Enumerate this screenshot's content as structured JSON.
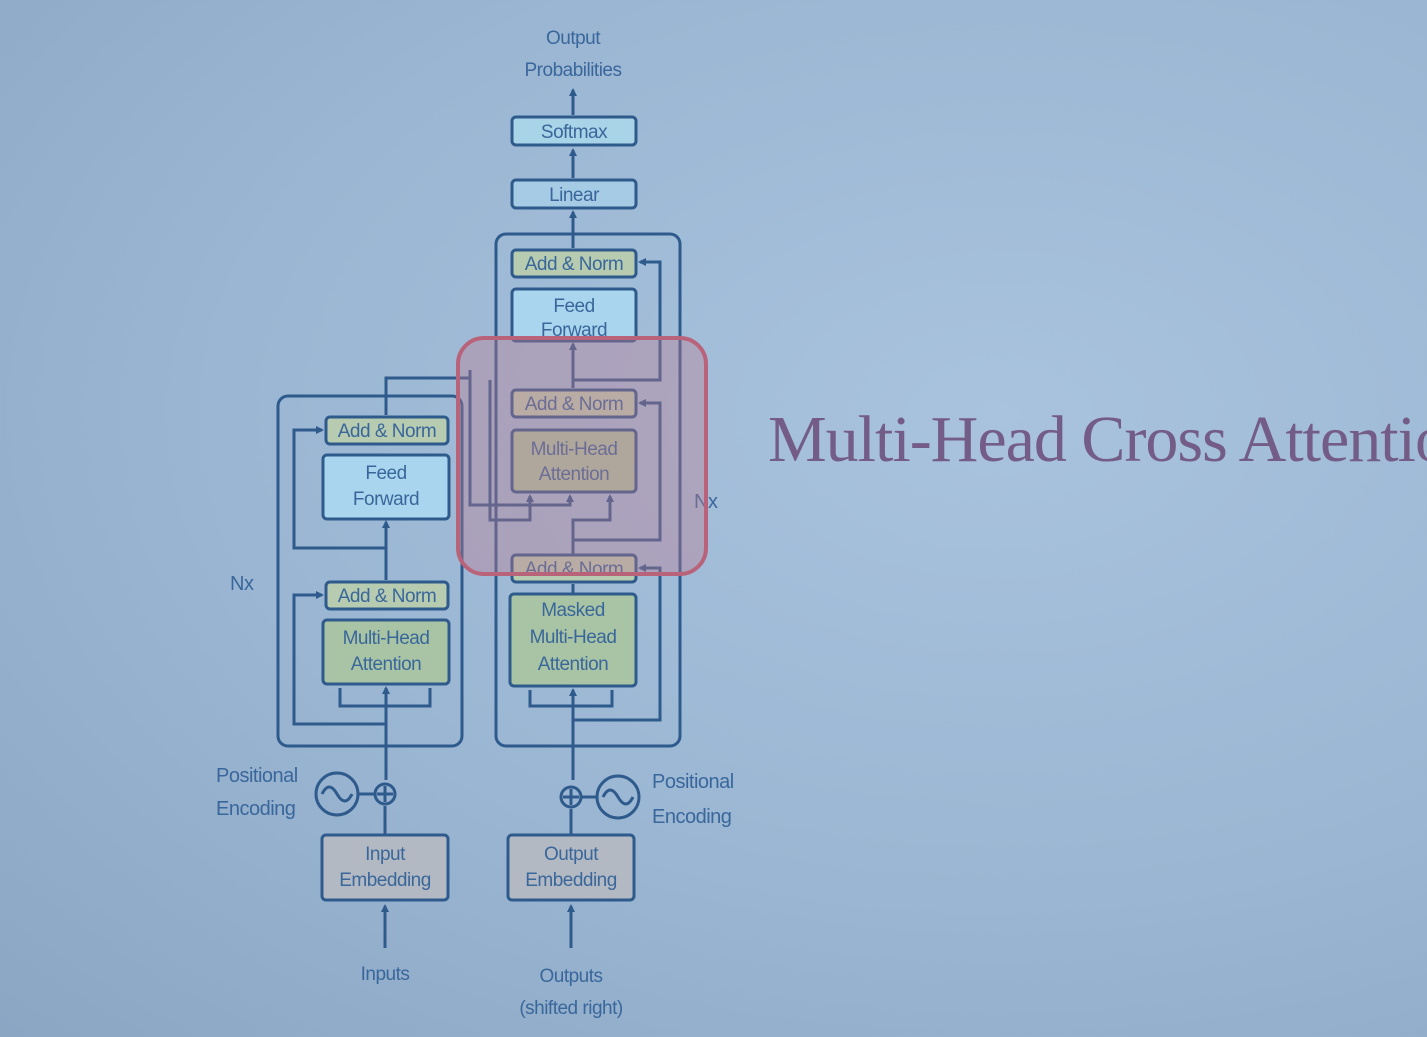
{
  "slide": {
    "title": "Multi-Head Cross Attention",
    "highlight_color": "#c0667a",
    "background_color": "#9ab6d2"
  },
  "diagram": {
    "output_label_line1": "Output",
    "output_label_line2": "Probabilities",
    "softmax": "Softmax",
    "linear": "Linear",
    "encoder": {
      "add_norm_top": "Add & Norm",
      "feed_forward_line1": "Feed",
      "feed_forward_line2": "Forward",
      "add_norm_bottom": "Add & Norm",
      "attention_line1": "Multi-Head",
      "attention_line2": "Attention",
      "repeat": "Nx",
      "positional_line1": "Positional",
      "positional_line2": "Encoding",
      "embedding_line1": "Input",
      "embedding_line2": "Embedding",
      "input_label": "Inputs"
    },
    "decoder": {
      "add_norm_top": "Add & Norm",
      "feed_forward_line1": "Feed",
      "feed_forward_line2": "Forward",
      "add_norm_mid": "Add & Norm",
      "cross_attention_line1": "Multi-Head",
      "cross_attention_line2": "Attention",
      "add_norm_bottom": "Add & Norm",
      "masked_line1": "Masked",
      "masked_line2": "Multi-Head",
      "masked_line3": "Attention",
      "repeat": "Nx",
      "positional_line1": "Positional",
      "positional_line2": "Encoding",
      "embedding_line1": "Output",
      "embedding_line2": "Embedding",
      "output_label_line1": "Outputs",
      "output_label_line2": "(shifted right)"
    }
  }
}
